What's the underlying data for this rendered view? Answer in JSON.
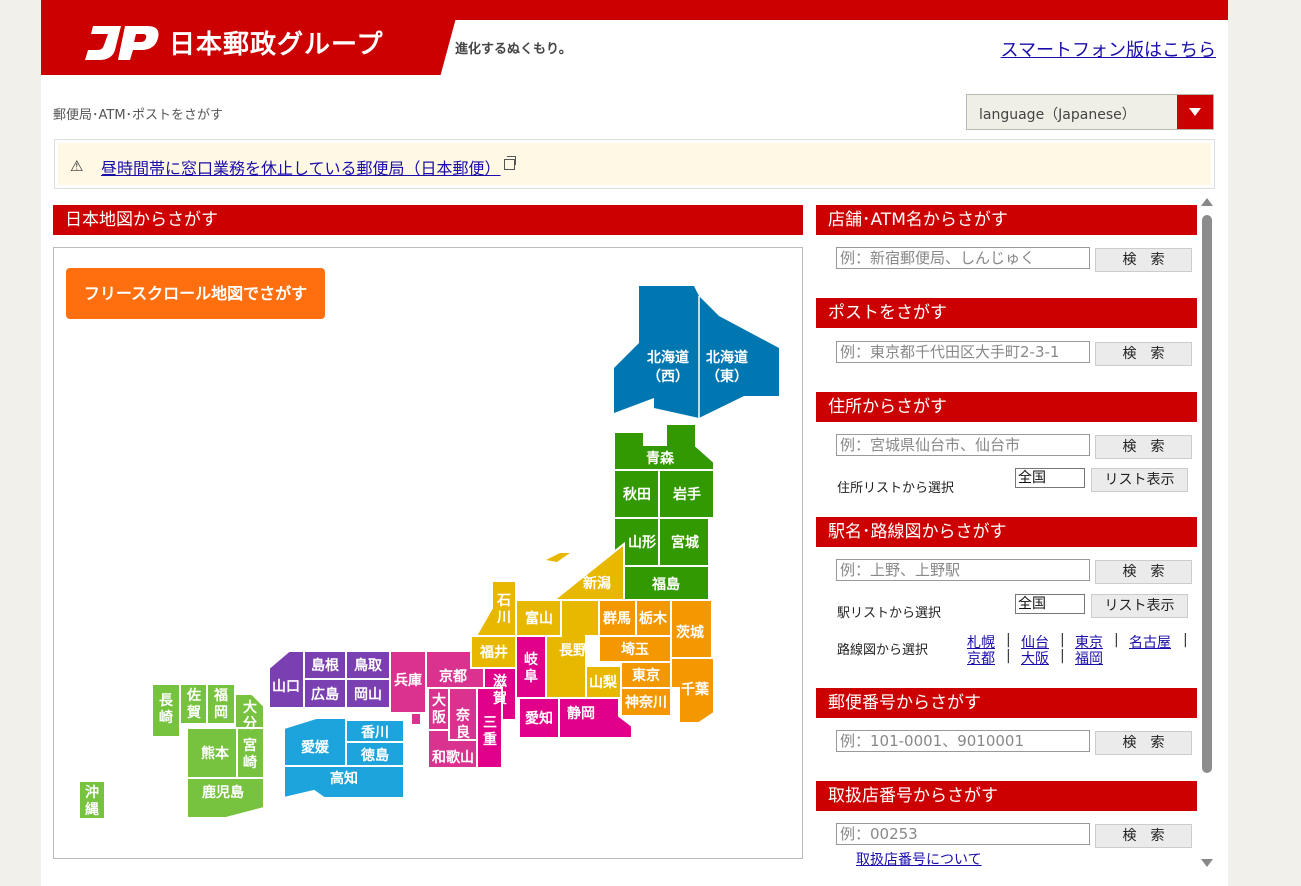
{
  "header": {
    "group_name": "日本郵政グループ",
    "tagline": "進化するぬくもり。",
    "smartphone_link": "スマートフォン版はこちら"
  },
  "breadcrumb": "郵便局･ATM･ポストをさがす",
  "language": {
    "label": "language（Japanese）"
  },
  "notice": {
    "link": "昼時間帯に窓口業務を休止している郵便局（日本郵便）"
  },
  "map_section": {
    "title": "日本地図からさがす",
    "free_scroll_button": "フリースクロール地図でさがす",
    "prefectures": {
      "hokkaido_w": [
        "北海道",
        "（西）"
      ],
      "hokkaido_e": [
        "北海道",
        "（東）"
      ],
      "aomori": "青森",
      "akita": "秋田",
      "iwate": "岩手",
      "yamagata": "山形",
      "miyagi": "宮城",
      "niigata": "新潟",
      "fukushima": "福島",
      "ishikawa": [
        "石",
        "川"
      ],
      "toyama": "富山",
      "gunma": "群馬",
      "tochigi": "栃木",
      "ibaraki": [
        "茨",
        "城"
      ],
      "nagano": "長野",
      "saitama": "埼玉",
      "fukui": "福井",
      "gifu": [
        "岐",
        "阜"
      ],
      "yamanashi": "山梨",
      "tokyo": "東京",
      "chiba": "千葉",
      "kanagawa": "神奈川",
      "shizuoka": "静岡",
      "aichi": "愛知",
      "shiga": [
        "滋",
        "賀"
      ],
      "kyoto": "京都",
      "mie": [
        "三",
        "重"
      ],
      "nara": [
        "奈",
        "良"
      ],
      "osaka": [
        "大",
        "阪"
      ],
      "wakayama": "和歌山",
      "hyogo": "兵庫",
      "tottori": "鳥取",
      "shimane": "島根",
      "okayama": "岡山",
      "hiroshima": "広島",
      "yamaguchi": "山口",
      "kagawa": "香川",
      "tokushima": "徳島",
      "ehime": "愛媛",
      "kochi": "高知",
      "fukuoka": [
        "福",
        "岡"
      ],
      "saga": [
        "佐",
        "賀"
      ],
      "nagasaki": [
        "長",
        "崎"
      ],
      "oita": [
        "大",
        "分"
      ],
      "kumamoto": "熊本",
      "miyazaki": [
        "宮",
        "崎"
      ],
      "kagoshima": "鹿児島",
      "okinawa": [
        "沖",
        "縄"
      ]
    }
  },
  "search": {
    "store": {
      "title": "店舗･ATM名からさがす",
      "placeholder": "例：新宿郵便局、しんじゅく",
      "button": "検　索"
    },
    "post": {
      "title": "ポストをさがす",
      "placeholder": "例：東京都千代田区大手町2-3-1",
      "button": "検　索"
    },
    "address": {
      "title": "住所からさがす",
      "placeholder": "例：宮城県仙台市、仙台市",
      "button": "検　索",
      "list_label": "住所リストから選択",
      "select": "全国",
      "list_button": "リスト表示"
    },
    "station": {
      "title": "駅名･路線図からさがす",
      "placeholder": "例：上野、上野駅",
      "button": "検　索",
      "list_label": "駅リストから選択",
      "select": "全国",
      "list_button": "リスト表示",
      "route_label": "路線図から選択",
      "routes": [
        "札幌",
        "仙台",
        "東京",
        "名古屋",
        "京都",
        "大阪",
        "福岡"
      ]
    },
    "postal": {
      "title": "郵便番号からさがす",
      "placeholder": "例：101-0001、9010001",
      "button": "検　索"
    },
    "branch": {
      "title": "取扱店番号からさがす",
      "placeholder": "例：00253",
      "button": "検　索",
      "about_link": "取扱店番号について"
    }
  },
  "colors": {
    "brand_red": "#cc0000",
    "hokkaido": "#0077b0",
    "tohoku": "#339900",
    "kanto": "#f39800",
    "chubu": "#e8b800",
    "kinki": "#e0008a",
    "kinki2": "#d9338f",
    "chugoku": "#7a3fb0",
    "shikoku": "#1ea4dc",
    "kyushu": "#77c23e",
    "orange_button": "#ff6f0f"
  }
}
